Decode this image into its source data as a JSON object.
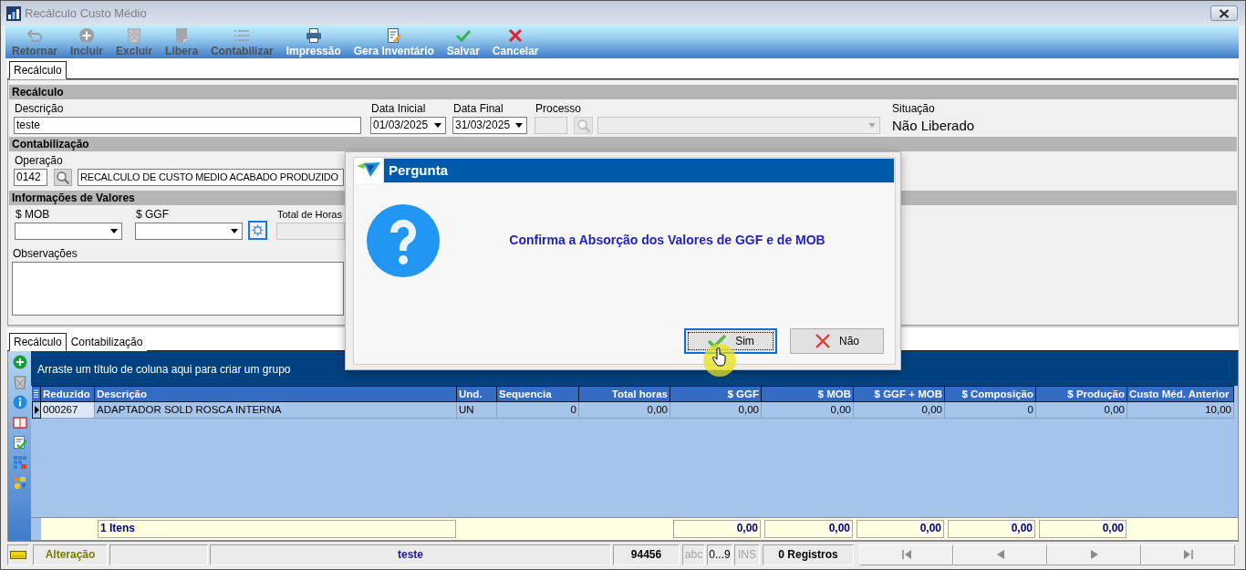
{
  "window": {
    "title": "Recálculo Custo Médio"
  },
  "toolbar": [
    {
      "kind": "return",
      "label": "Retornar",
      "disabled": true
    },
    {
      "kind": "add",
      "label": "Incluir",
      "disabled": true
    },
    {
      "kind": "delete",
      "label": "Excluir",
      "disabled": true
    },
    {
      "kind": "release",
      "label": "Libera",
      "disabled": true
    },
    {
      "kind": "post",
      "label": "Contabilizar",
      "disabled": true
    },
    {
      "kind": "print",
      "label": "Impressão",
      "disabled": false
    },
    {
      "kind": "inventory",
      "label": "Gera Inventário",
      "disabled": false
    },
    {
      "kind": "save",
      "label": "Salvar",
      "disabled": false
    },
    {
      "kind": "cancel",
      "label": "Cancelar",
      "disabled": false
    }
  ],
  "form_tabs": [
    {
      "label": "Recálculo",
      "selected": true
    }
  ],
  "recalculo": {
    "heading": "Recálculo",
    "descricao": {
      "label": "Descrição",
      "value": "teste"
    },
    "data_inicial": {
      "label": "Data Inicial",
      "value": "01/03/2025"
    },
    "data_final": {
      "label": "Data Final",
      "value": "31/03/2025"
    },
    "processo": {
      "label": "Processo",
      "disabled": true
    },
    "situacao": {
      "label": "Situação",
      "value": "Não Liberado"
    }
  },
  "contabilizacao": {
    "heading": "Contabilização",
    "operacao": {
      "label": "Operação",
      "code": "0142",
      "description": "RECALCULO DE CUSTO MEDIO ACABADO PRODUZIDO"
    }
  },
  "valores": {
    "heading": "Informações de Valores",
    "mob": {
      "label": "$ MOB"
    },
    "ggf": {
      "label": "$ GGF"
    },
    "total_horas": {
      "label": "Total de Horas",
      "disabled": true
    },
    "observacoes": {
      "label": "Observações"
    }
  },
  "detail_tabs": [
    {
      "label": "Recálculo",
      "selected": true
    },
    {
      "label": "Contabilização",
      "selected": false
    }
  ],
  "grid": {
    "group_hint": "Arraste um título de coluna aqui para criar um grupo",
    "columns": [
      "Reduzido",
      "Descrição",
      "Und.",
      "Sequencia",
      "Total horas",
      "$ GGF",
      "$ MOB",
      "$ GGF + MOB",
      "$ Composição",
      "$ Produção",
      "Custo Méd. Anterior"
    ],
    "rows": [
      {
        "selected": true,
        "cells": [
          "000267",
          "ADAPTADOR SOLD ROSCA INTERNA",
          "UN",
          "0",
          "0,00",
          "0,00",
          "0,00",
          "0,00",
          "0",
          "0,00",
          "10,00"
        ]
      }
    ],
    "footer": {
      "count": "1 Itens",
      "totals": [
        "0,00",
        "0,00",
        "0,00",
        "0,00",
        "0,00"
      ]
    }
  },
  "status_bar": {
    "mode": "Alteração",
    "text": "teste",
    "number": "94456",
    "indicators": [
      {
        "label": "abc",
        "on": false
      },
      {
        "label": "0...9",
        "on": true
      },
      {
        "label": "INS",
        "on": false
      }
    ],
    "records": "0 Registros"
  },
  "dialog": {
    "title": "Pergunta",
    "message": "Confirma a Absorção dos Valores de GGF e de MOB",
    "buttons": [
      {
        "kind": "yes",
        "label": "Sim",
        "focused": true
      },
      {
        "kind": "no",
        "label": "Não",
        "focused": false
      }
    ]
  }
}
